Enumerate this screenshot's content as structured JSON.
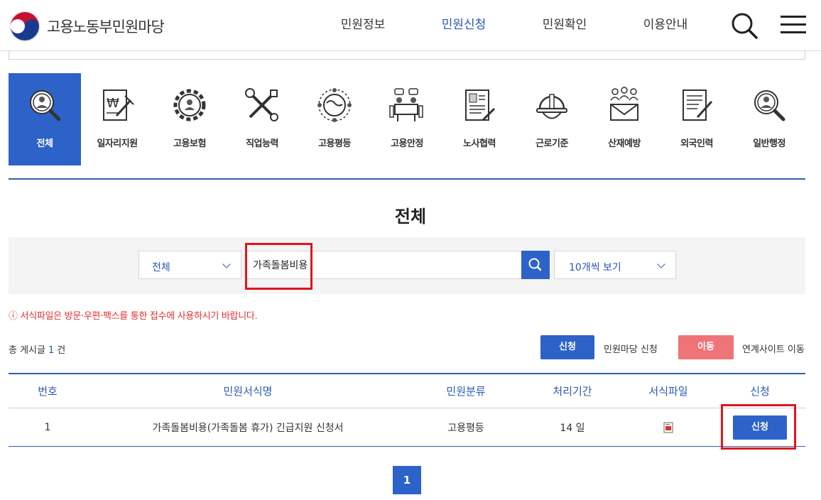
{
  "header": {
    "logo_text": "고용노동부민원마당",
    "nav": [
      {
        "label": "민원정보",
        "active": false
      },
      {
        "label": "민원신청",
        "active": true
      },
      {
        "label": "민원확인",
        "active": false
      },
      {
        "label": "이용안내",
        "active": false
      }
    ],
    "search_icon": "search-icon",
    "menu_icon": "hamburger-menu-icon"
  },
  "categories": [
    {
      "label": "전체",
      "icon": "magnifier-person-icon",
      "active": true
    },
    {
      "label": "일자리지원",
      "icon": "won-document-icon",
      "active": false
    },
    {
      "label": "고용보험",
      "icon": "gear-person-icon",
      "active": false
    },
    {
      "label": "직업능력",
      "icon": "tools-icon",
      "active": false
    },
    {
      "label": "고용평등",
      "icon": "globe-people-icon",
      "active": false
    },
    {
      "label": "고용안정",
      "icon": "meeting-icon",
      "active": false
    },
    {
      "label": "노사협력",
      "icon": "contract-icon",
      "active": false
    },
    {
      "label": "근로기준",
      "icon": "helmet-icon",
      "active": false
    },
    {
      "label": "산재예방",
      "icon": "mail-people-icon",
      "active": false
    },
    {
      "label": "외국인력",
      "icon": "form-pen-icon",
      "active": false
    },
    {
      "label": "일반행정",
      "icon": "magnifier-person-icon",
      "active": false
    }
  ],
  "page_title": "전체",
  "search": {
    "category_value": "전체",
    "query_value": "가족돌봄비용",
    "count_value": "10개씩 보기"
  },
  "notice": "ⓘ 서식파일은 방문·우편·팩스를 통한 접수에 사용하시기 바랍니다.",
  "total": {
    "prefix": "총 게시글",
    "count": "1",
    "suffix": "건"
  },
  "legend": {
    "apply_label": "신청",
    "apply_desc": "민원마당 신청",
    "move_label": "이동",
    "move_desc": "연계사이트 이동"
  },
  "table": {
    "headers": [
      "번호",
      "민원서식명",
      "민원분류",
      "처리기간",
      "서식파일",
      "신청"
    ],
    "rows": [
      {
        "no": "1",
        "name": "가족돌봄비용(가족돌봄 휴가) 긴급지원 신청서",
        "category": "고용평등",
        "period": "14 일",
        "file_icon": "hwp-file-icon",
        "apply_label": "신청"
      }
    ]
  },
  "pagination": {
    "current": "1"
  },
  "colors": {
    "primary": "#2d63c8",
    "nav_active": "#2d57b3",
    "move": "#ef7478",
    "notice": "#e03030",
    "highlight": "#e0161e"
  }
}
